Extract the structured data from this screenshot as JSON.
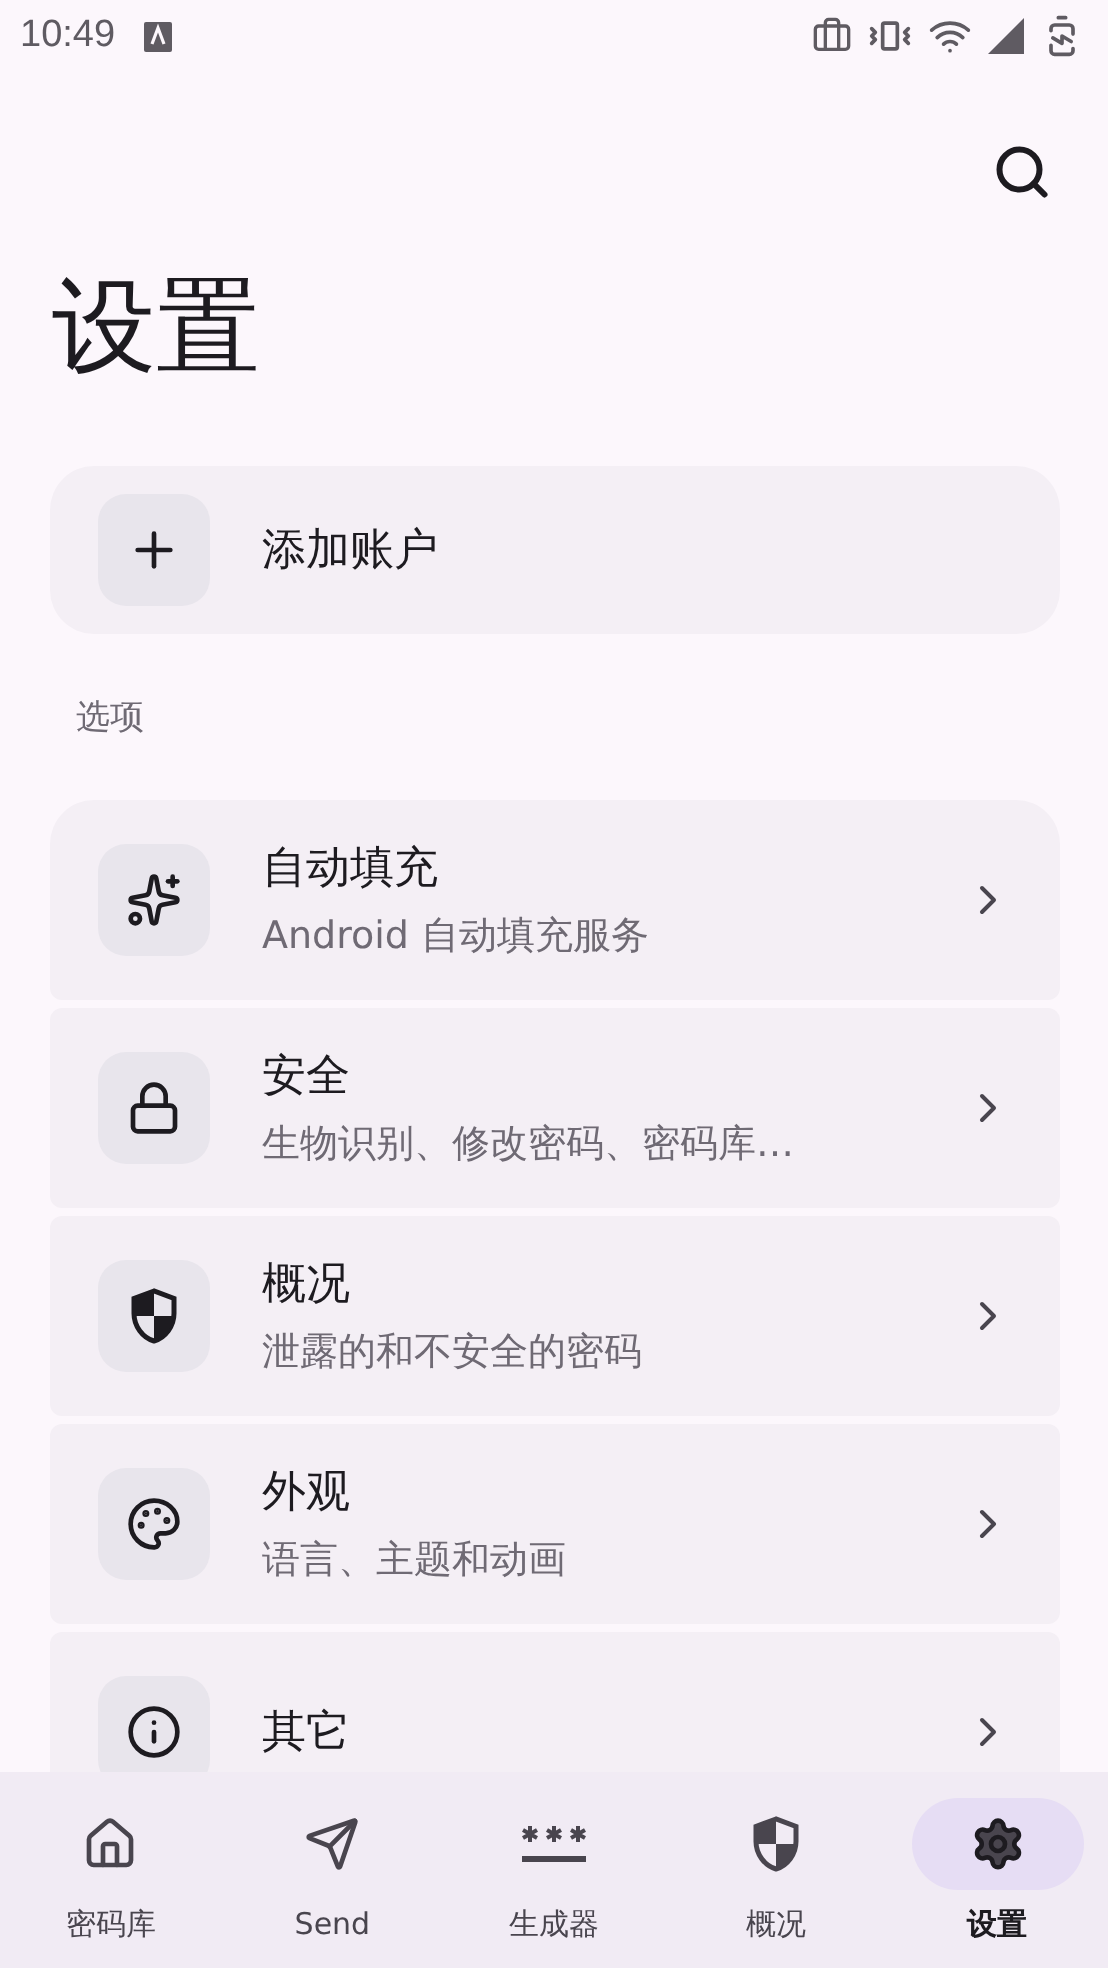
{
  "status_bar": {
    "time": "10:49"
  },
  "title": "设置",
  "add_account": {
    "label": "添加账户"
  },
  "section_label": "选项",
  "items": [
    {
      "kind": "autofill",
      "title": "自动填充",
      "subtitle": "Android 自动填充服务"
    },
    {
      "kind": "security",
      "title": "安全",
      "subtitle": "生物识别、修改密码、密码库…"
    },
    {
      "kind": "overview",
      "title": "概况",
      "subtitle": "泄露的和不安全的密码"
    },
    {
      "kind": "appearance",
      "title": "外观",
      "subtitle": "语言、主题和动画"
    },
    {
      "kind": "other",
      "title": "其它"
    }
  ],
  "nav": [
    {
      "kind": "vault",
      "label": "密码库",
      "selected": false
    },
    {
      "kind": "send",
      "label": "Send",
      "selected": false
    },
    {
      "kind": "generator",
      "label": "生成器",
      "selected": false
    },
    {
      "kind": "overview",
      "label": "概况",
      "selected": false
    },
    {
      "kind": "settings",
      "label": "设置",
      "selected": true
    }
  ]
}
